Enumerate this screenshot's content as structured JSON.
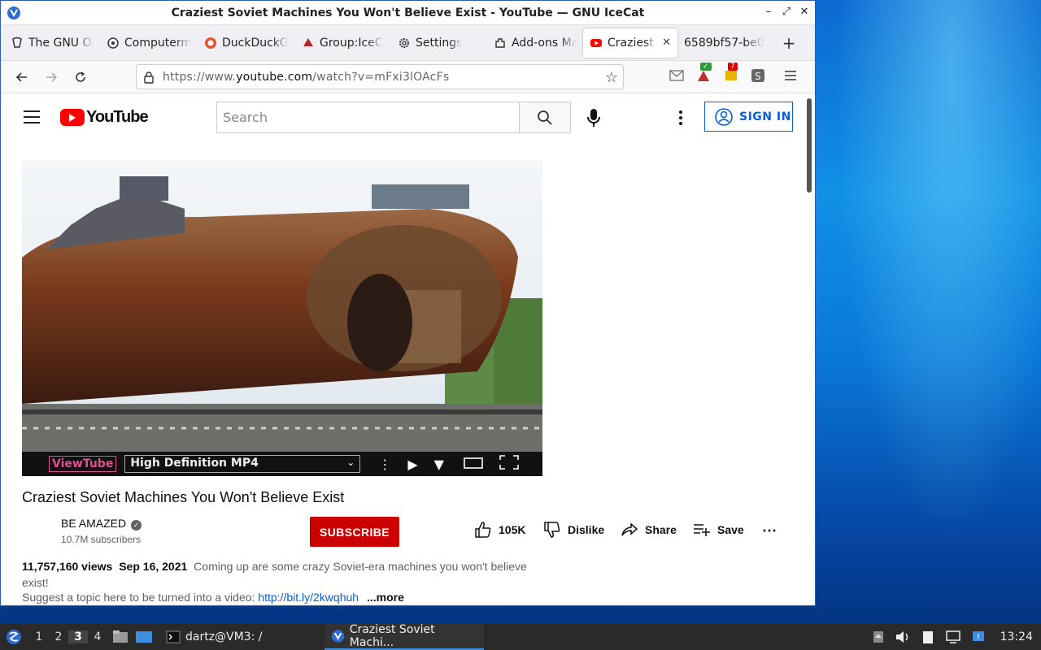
{
  "window": {
    "title": "Craziest Soviet Machines You Won't Believe Exist - YouTube — GNU IceCat"
  },
  "tabs": [
    {
      "label": "The GNU Op",
      "icon": "gnu-icon"
    },
    {
      "label": "Computerm",
      "icon": "computer-icon"
    },
    {
      "label": "DuckDuckG",
      "icon": "duckduckgo-icon"
    },
    {
      "label": "Group:IceC",
      "icon": "icecat-group-icon"
    },
    {
      "label": "Settings",
      "icon": "gear-icon"
    },
    {
      "label": "Add-ons Ma",
      "icon": "puzzle-icon"
    },
    {
      "label": "Craziest S",
      "icon": "youtube-icon",
      "active": true
    },
    {
      "label": "6589bf57-be0",
      "icon": ""
    }
  ],
  "url": {
    "prefix": "https://www.",
    "domain": "youtube.com",
    "path": "/watch?v=mFxi3lOAcFs"
  },
  "ext_badges": {
    "green": "✓",
    "red": "7"
  },
  "youtube": {
    "logo_text": "YouTube",
    "search_placeholder": "Search",
    "signin_label": "SIGN IN"
  },
  "player": {
    "viewtube_label": "ViewTube",
    "format": "High Definition MP4"
  },
  "video": {
    "title": "Craziest Soviet Machines You Won't Believe Exist",
    "channel": "BE AMAZED",
    "subscribers": "10.7M subscribers",
    "subscribe_label": "SUBSCRIBE",
    "likes": "105K",
    "dislike_label": "Dislike",
    "share_label": "Share",
    "save_label": "Save",
    "views": "11,757,160 views",
    "date": "Sep 16, 2021",
    "desc_line1": "Coming up are some crazy Soviet-era machines you won't believe exist!",
    "desc_line2": "Suggest a topic here to be turned into a video:",
    "desc_link": "http://bit.ly/2kwqhuh",
    "more_label": "...more"
  },
  "taskbar": {
    "workspaces": [
      "1",
      "2",
      "3",
      "4"
    ],
    "active_workspace": "3",
    "terminal_task": "dartz@VM3: /",
    "browser_task": "Craziest Soviet Machi...",
    "clock": "13:24"
  }
}
